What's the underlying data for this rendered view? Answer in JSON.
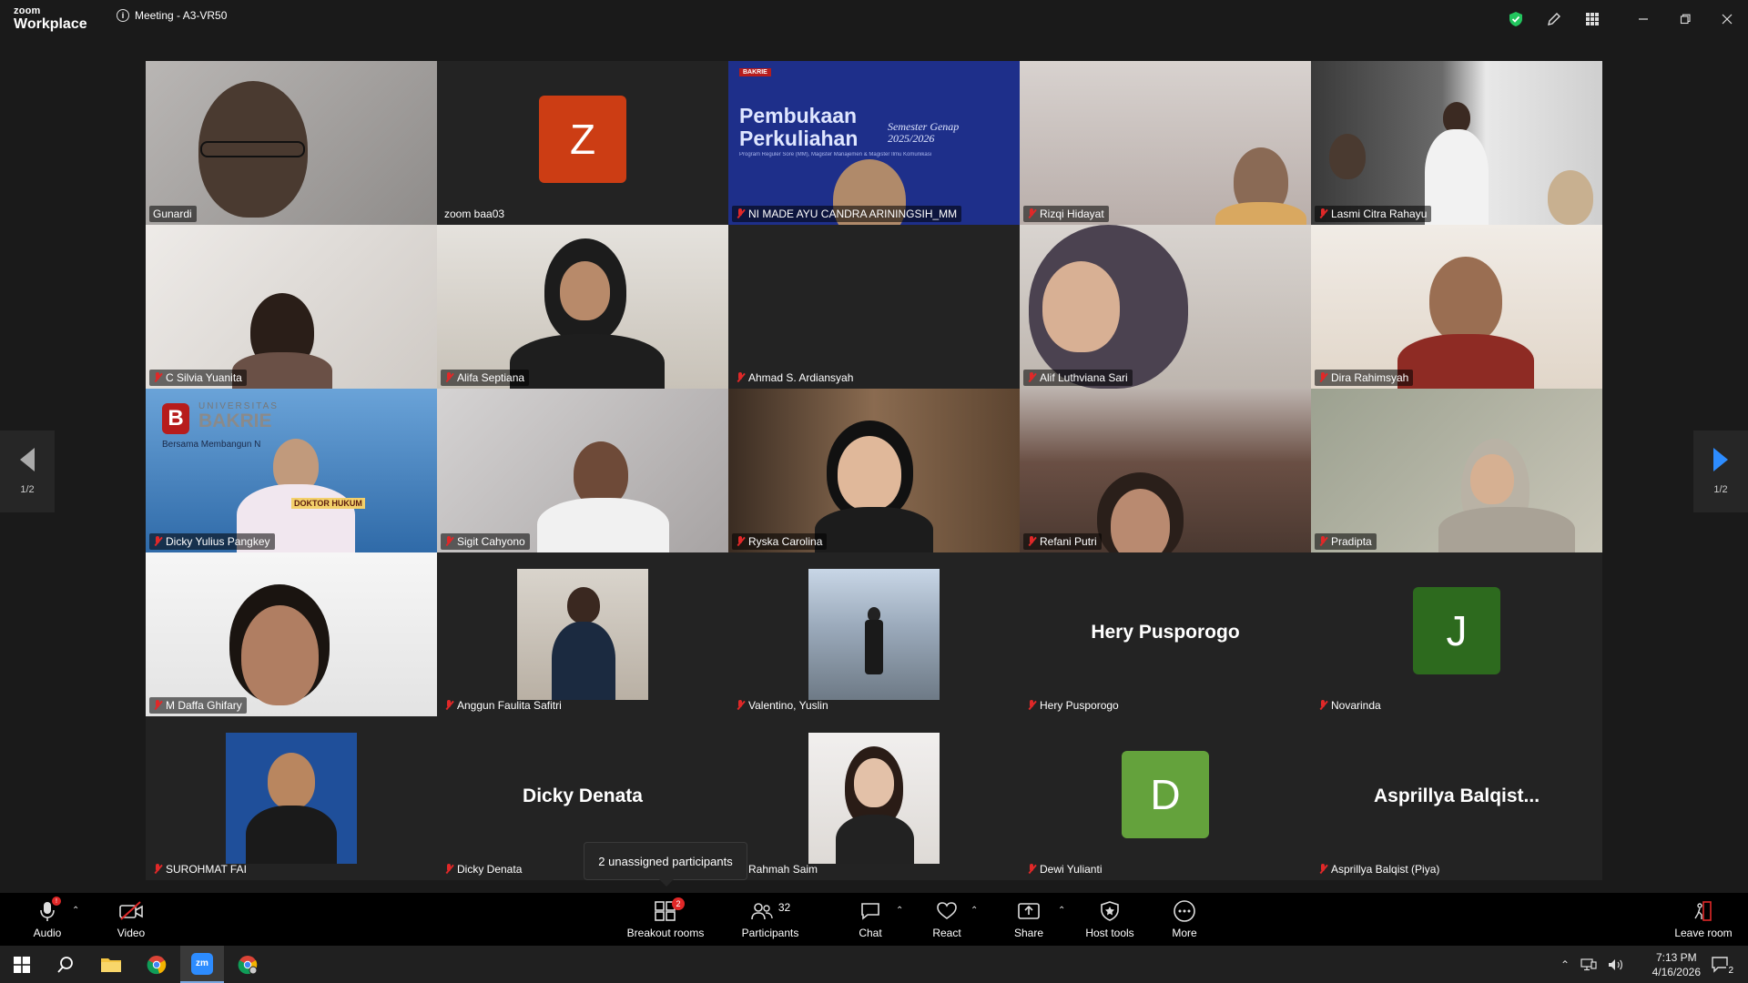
{
  "app": {
    "logo_top": "zoom",
    "logo_bottom": "Workplace",
    "meeting_title": "Meeting - A3-VR50"
  },
  "participants": [
    {
      "name": "Gunardi",
      "type": "video",
      "active": true,
      "muted": false
    },
    {
      "name": "zoom baa03",
      "type": "letter",
      "letter": "Z",
      "color": "#cc3d14",
      "muted": false
    },
    {
      "name": "NI MADE AYU CANDRA ARININGSIH_MM",
      "type": "slide",
      "muted": true
    },
    {
      "name": "Rizqi Hidayat",
      "type": "video",
      "muted": true
    },
    {
      "name": "Lasmi Citra Rahayu",
      "type": "video",
      "muted": true
    },
    {
      "name": "C Silvia Yuanita",
      "type": "video",
      "muted": true
    },
    {
      "name": "Alifa Septiana",
      "type": "video",
      "muted": true
    },
    {
      "name": "Ahmad S. Ardiansyah",
      "type": "dark",
      "muted": true
    },
    {
      "name": "Alif Luthviana Sari",
      "type": "video",
      "muted": true
    },
    {
      "name": "Dira Rahimsyah",
      "type": "video",
      "muted": true
    },
    {
      "name": "Dicky Yulius Pangkey",
      "type": "video",
      "muted": true
    },
    {
      "name": "Sigit Cahyono",
      "type": "video",
      "muted": true
    },
    {
      "name": "Ryska Carolina",
      "type": "video",
      "muted": true
    },
    {
      "name": "Refani Putri",
      "type": "video",
      "muted": true
    },
    {
      "name": "Pradipta",
      "type": "video",
      "muted": true
    },
    {
      "name": "M Daffa Ghifary",
      "type": "video",
      "muted": true
    },
    {
      "name": "Anggun Faulita Safitri",
      "type": "photo",
      "muted": true
    },
    {
      "name": "Valentino, Yuslin",
      "type": "photo",
      "muted": true
    },
    {
      "name": "Hery Pusporogo",
      "type": "name",
      "display": "Hery Pusporogo",
      "muted": true
    },
    {
      "name": "Novarinda",
      "type": "letter",
      "letter": "J",
      "color": "#2d6a1e",
      "muted": true
    },
    {
      "name": "SUROHMAT FAI",
      "type": "photo",
      "muted": true
    },
    {
      "name": "Dicky Denata",
      "type": "name",
      "display": "Dicky Denata",
      "muted": true
    },
    {
      "name": "Rahmah Saim",
      "type": "photo",
      "muted": true
    },
    {
      "name": "Dewi Yulianti",
      "type": "letter",
      "letter": "D",
      "color": "#64a23c",
      "muted": true
    },
    {
      "name": "Asprillya Balqist (Piya)",
      "type": "name",
      "display": "Asprillya  Balqist...",
      "muted": true
    }
  ],
  "slide": {
    "brand": "BAKRIE",
    "title1": "Pembukaan",
    "title2": "Perkuliahan",
    "subtitle1": "Semester Genap",
    "subtitle2": "2025/2026",
    "tagline": "Program Reguler Sore (MM), Magister Manajemen & Magister Ilmu Komunikasi"
  },
  "banner": {
    "university": "UNIVERSITAS",
    "brand": "BAKRIE",
    "motto": "Bersama Membangun N",
    "sign": "DOKTOR HUKUM"
  },
  "pager": {
    "left_label": "1/2",
    "right_label": "1/2"
  },
  "tooltip": "2 unassigned participants",
  "toolbar": {
    "audio": "Audio",
    "video": "Video",
    "breakout": "Breakout rooms",
    "breakout_badge": "2",
    "participants": "Participants",
    "participants_count": "32",
    "chat": "Chat",
    "react": "React",
    "share": "Share",
    "host_tools": "Host tools",
    "more": "More",
    "leave": "Leave room"
  },
  "taskbar": {
    "time": "7:13 PM",
    "date": "4/16/2026",
    "notifications": "2",
    "zoom_label": "zm"
  }
}
